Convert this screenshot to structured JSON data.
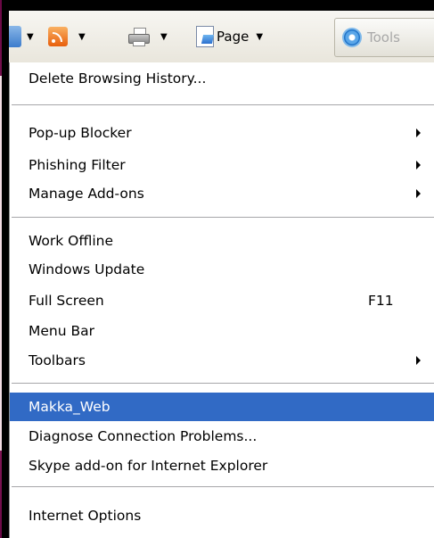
{
  "toolbar": {
    "page_label": "Page",
    "tools_label": "Tools",
    "icons": [
      "home-icon",
      "rss-feed-icon",
      "print-icon",
      "page-icon",
      "gear-icon"
    ]
  },
  "menu": {
    "items": [
      {
        "label": "Delete Browsing History..."
      },
      {
        "label": "Pop-up Blocker",
        "submenu": true
      },
      {
        "label": "Phishing Filter",
        "submenu": true
      },
      {
        "label": "Manage Add-ons",
        "submenu": true
      },
      {
        "label": "Work Offline"
      },
      {
        "label": "Windows Update"
      },
      {
        "label": "Full Screen",
        "shortcut": "F11"
      },
      {
        "label": "Menu Bar"
      },
      {
        "label": "Toolbars",
        "submenu": true
      },
      {
        "label": "Makka_Web",
        "selected": true
      },
      {
        "label": "Diagnose Connection Problems..."
      },
      {
        "label": "Skype add-on for Internet Explorer"
      },
      {
        "label": "Internet Options"
      }
    ]
  },
  "colors": {
    "selection": "#316ac5",
    "background": "#6e0a4a"
  }
}
